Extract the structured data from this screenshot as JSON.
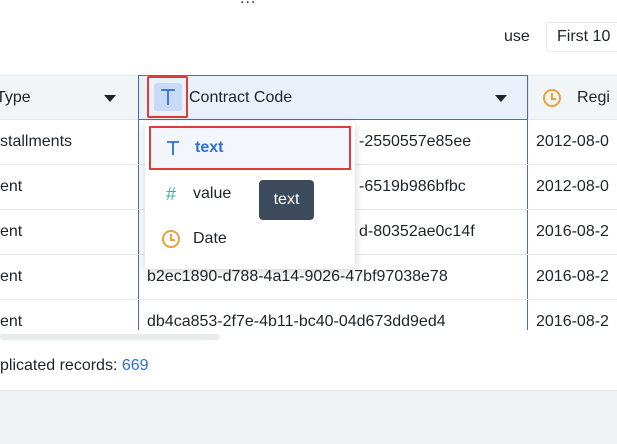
{
  "top": {
    "ellipsis": "..."
  },
  "toolbar": {
    "use_label": "use",
    "sample_select_value": "First 10"
  },
  "table": {
    "headers": [
      {
        "label": "Type",
        "icon": "none"
      },
      {
        "label": "Contract Code",
        "icon": "text-type-icon"
      },
      {
        "label": "Regi",
        "icon": "clock-icon"
      }
    ],
    "rows": [
      [
        "stallments",
        "-2550557e85ee",
        "2012-08-0"
      ],
      [
        "ent",
        "-6519b986bfbc",
        "2012-08-0"
      ],
      [
        "ent",
        "d-80352ae0c14f",
        "2016-08-2"
      ],
      [
        "ent",
        "b2ec1890-d788-4a14-9026-47bf97038e78",
        "2016-08-2"
      ],
      [
        "ent",
        "db4ca853-2f7e-4b11-bc40-04d673dd9ed4",
        "2016-08-2"
      ]
    ]
  },
  "type_menu": {
    "items": [
      {
        "label": "text",
        "icon_glyph": "T",
        "icon": "text-type-icon",
        "color": "#2f6fd6"
      },
      {
        "label": "value",
        "icon_glyph": "#",
        "icon": "hash-icon",
        "color": "#3bb3a0"
      },
      {
        "label": "Date",
        "icon_glyph": "◷",
        "icon": "clock-icon",
        "color": "#e8a33d"
      }
    ],
    "tooltip": "text"
  },
  "summary": {
    "label": "plicated records:",
    "count": "669"
  },
  "colors": {
    "accent": "#2f6fd6",
    "highlight": "#e03a3a",
    "tooltip_bg": "#3d4a5c"
  }
}
